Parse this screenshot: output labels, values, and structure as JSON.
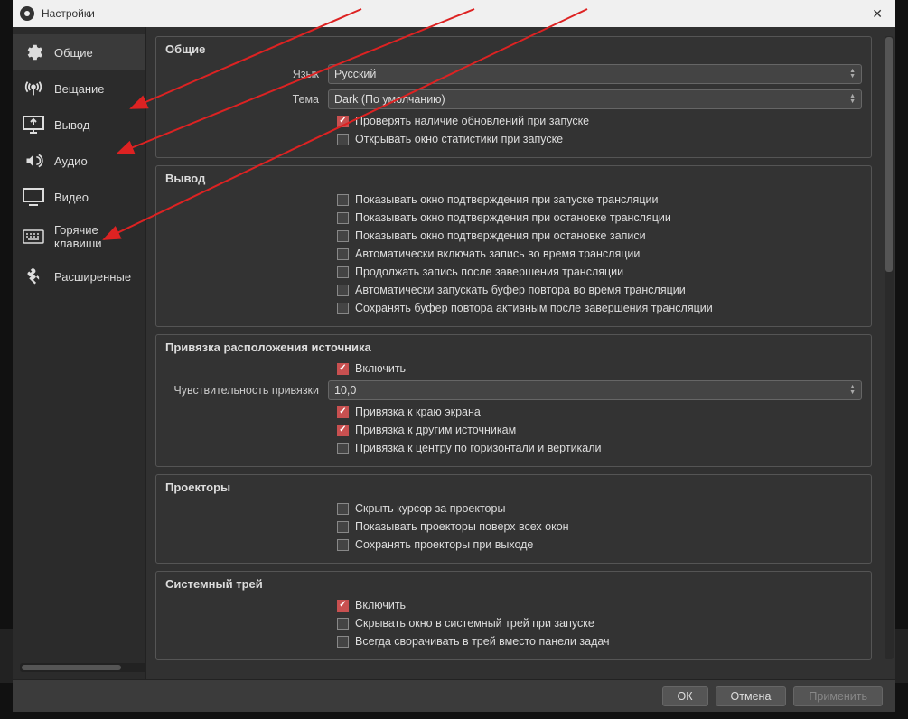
{
  "window": {
    "title": "Настройки"
  },
  "sidebar": {
    "items": [
      {
        "label": "Общие"
      },
      {
        "label": "Вещание"
      },
      {
        "label": "Вывод"
      },
      {
        "label": "Аудио"
      },
      {
        "label": "Видео"
      },
      {
        "label": "Горячие клавиши"
      },
      {
        "label": "Расширенные"
      }
    ]
  },
  "groups": {
    "general": {
      "title": "Общие",
      "language_label": "Язык",
      "language_value": "Русский",
      "theme_label": "Тема",
      "theme_value": "Dark (По умолчанию)",
      "check_updates": "Проверять наличие обновлений при запуске",
      "open_stats": "Открывать окно статистики при запуске"
    },
    "output": {
      "title": "Вывод",
      "confirm_start": "Показывать окно подтверждения при запуске трансляции",
      "confirm_stop_stream": "Показывать окно подтверждения при остановке трансляции",
      "confirm_stop_rec": "Показывать окно подтверждения при остановке записи",
      "auto_rec": "Автоматически включать запись во время трансляции",
      "keep_rec": "Продолжать запись после завершения трансляции",
      "auto_replay": "Автоматически запускать буфер повтора во время трансляции",
      "keep_replay": "Сохранять буфер повтора активным после завершения трансляции"
    },
    "snap": {
      "title": "Привязка расположения источника",
      "enable": "Включить",
      "sensitivity_label": "Чувствительность привязки",
      "sensitivity_value": "10,0",
      "edge": "Привязка к краю экрана",
      "other": "Привязка к другим источникам",
      "center": "Привязка к центру по горизонтали и вертикали"
    },
    "projectors": {
      "title": "Проекторы",
      "hide_cursor": "Скрыть курсор за проекторы",
      "on_top": "Показывать проекторы поверх всех окон",
      "save": "Сохранять проекторы при выходе"
    },
    "tray": {
      "title": "Системный трей",
      "enable": "Включить",
      "hide_on_start": "Скрывать окно в системный трей при запуске",
      "minimize_tray": "Всегда сворачивать в трей вместо панели задач"
    }
  },
  "footer": {
    "ok": "ОК",
    "cancel": "Отмена",
    "apply": "Применить"
  }
}
